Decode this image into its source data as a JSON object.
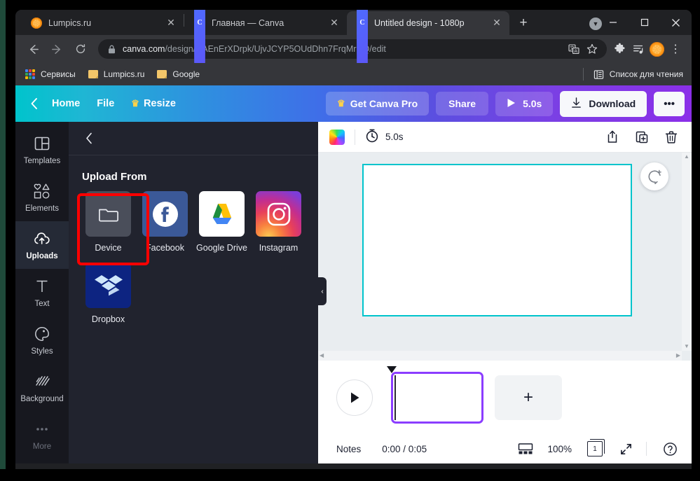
{
  "browser": {
    "tabs": [
      {
        "title": "Lumpics.ru",
        "favicon": "orange-slice-icon",
        "active": false
      },
      {
        "title": "Главная — Canva",
        "favicon": "canva-icon",
        "active": false
      },
      {
        "title": "Untitled design - 1080p",
        "favicon": "canva-icon",
        "active": true
      }
    ],
    "new_tab_label": "+",
    "window_controls": {
      "minimize": "—",
      "maximize": "□",
      "close": "✕"
    },
    "nav": {
      "back": "←",
      "forward": "→",
      "reload": "⟳"
    },
    "omnibox": {
      "lock": "lock-icon",
      "url_domain": "canva.com",
      "url_path": "/design/DAEnErXDrpk/UjvJCYP5OUdDhn7FrqMrHQ/edit",
      "translate": "translate-icon",
      "bookmark": "star-icon"
    },
    "toolbar_icons": [
      "extensions-icon",
      "reading-list-icon",
      "profile-avatar"
    ],
    "menu": "⋮",
    "bookmarks": [
      {
        "label": "Сервисы",
        "icon": "apps-grid-icon"
      },
      {
        "label": "Lumpics.ru",
        "icon": "folder-icon"
      },
      {
        "label": "Google",
        "icon": "folder-icon"
      }
    ],
    "reading_list": {
      "label": "Список для чтения",
      "icon": "reading-list-icon"
    }
  },
  "canva": {
    "topbar": {
      "back": "‹",
      "home": "Home",
      "file": "File",
      "resize": "Resize",
      "resize_icon": "crown-icon",
      "get_pro": "Get Canva Pro",
      "get_pro_icon": "crown-icon",
      "share": "Share",
      "play_duration": "5.0s",
      "play_icon": "play-icon",
      "download": "Download",
      "download_icon": "download-icon",
      "more": "•••"
    },
    "rail": [
      {
        "label": "Templates",
        "icon": "templates-icon",
        "active": false
      },
      {
        "label": "Elements",
        "icon": "elements-icon",
        "active": false
      },
      {
        "label": "Uploads",
        "icon": "uploads-cloud-icon",
        "active": true
      },
      {
        "label": "Text",
        "icon": "text-icon",
        "active": false
      },
      {
        "label": "Styles",
        "icon": "styles-palette-icon",
        "active": false
      },
      {
        "label": "Background",
        "icon": "background-icon",
        "active": false
      },
      {
        "label": "More",
        "icon": "more-dots-icon",
        "active": false
      }
    ],
    "panel": {
      "back": "‹",
      "title": "Upload From",
      "sources": [
        {
          "label": "Device",
          "icon": "folder-icon",
          "highlighted": true
        },
        {
          "label": "Facebook",
          "icon": "facebook-icon",
          "highlighted": false
        },
        {
          "label": "Google Drive",
          "icon": "google-drive-icon",
          "highlighted": false
        },
        {
          "label": "Instagram",
          "icon": "instagram-icon",
          "highlighted": false
        },
        {
          "label": "Dropbox",
          "icon": "dropbox-icon",
          "highlighted": false
        }
      ]
    },
    "stage_header": {
      "color_swatch": "rainbow-swatch-icon",
      "timer_icon": "timer-icon",
      "duration": "5.0s",
      "actions": [
        {
          "icon": "add-page-icon"
        },
        {
          "icon": "duplicate-page-icon"
        },
        {
          "icon": "delete-page-icon"
        }
      ]
    },
    "canvas": {
      "comment_icon": "add-comment-icon",
      "collapse_icon": "collapse-panel-icon"
    },
    "timeline": {
      "play_icon": "play-icon",
      "add_page_label": "+",
      "playhead": "playhead-marker"
    },
    "statusbar": {
      "notes": "Notes",
      "time": "0:00 / 0:05",
      "grid_icon": "page-grid-icon",
      "zoom": "100%",
      "page_count": "1",
      "fullscreen_icon": "fullscreen-icon",
      "help_icon": "help-icon"
    }
  },
  "annotation": {
    "color": "#fe0000",
    "target": "Device"
  }
}
